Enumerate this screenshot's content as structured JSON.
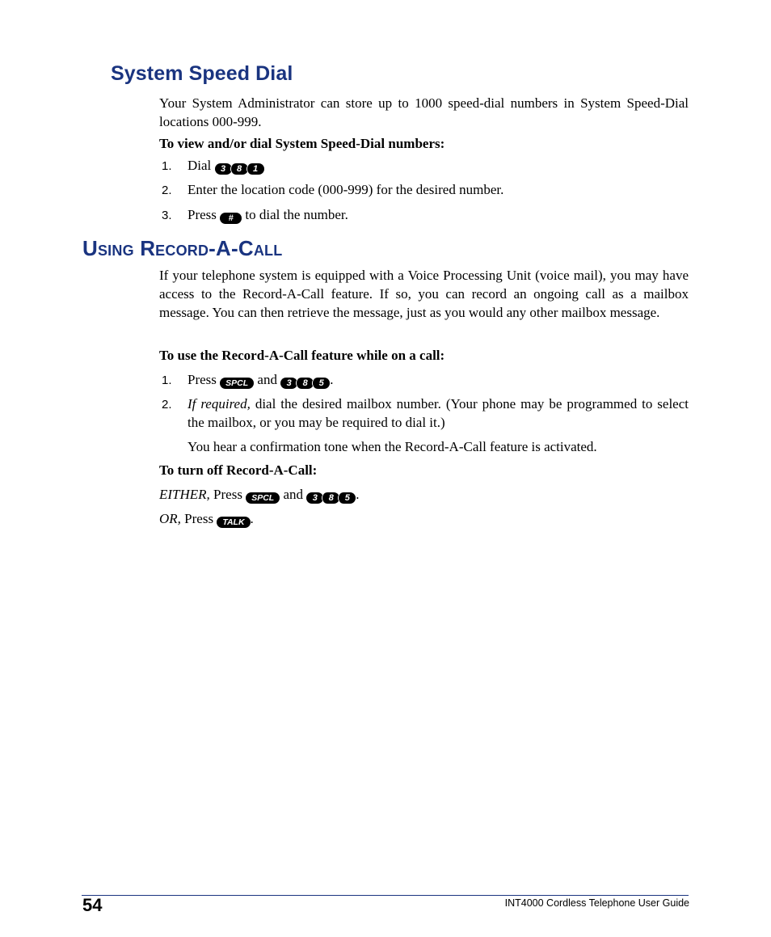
{
  "section1": {
    "heading": "System Speed Dial",
    "intro": "Your System Administrator can store up to 1000 speed-dial numbers in System Speed-Dial locations 000-999.",
    "subheading": "To view and/or dial System Speed-Dial numbers:",
    "steps": [
      {
        "num": "1.",
        "before": "Dial",
        "keys": [
          "3",
          "8",
          "1"
        ],
        "after": ""
      },
      {
        "num": "2.",
        "text": "Enter the location code (000-999) for the desired number."
      },
      {
        "num": "3.",
        "before": "Press",
        "key": "#",
        "after": "to dial the number."
      }
    ]
  },
  "section2": {
    "heading": "Using Record-A-Call",
    "intro": "If your telephone system is equipped with a Voice Processing Unit (voice mail), you may have access to the Record-A-Call feature. If so, you can record an ongoing call as a mailbox message. You can then retrieve the message, just as you would any other mailbox message.",
    "subheading": "To use the Record-A-Call feature while on a call:",
    "steps": [
      {
        "num": "1.",
        "before": "Press",
        "key": "SPCL",
        "mid": "and",
        "keys": [
          "3",
          "8",
          "5"
        ],
        "after": "."
      },
      {
        "num": "2.",
        "italic": "If required,",
        "text": "dial the desired mailbox number. (Your phone may be programmed to select the mailbox, or you may be required to dial it.)"
      }
    ],
    "note": "You hear a confirmation tone when the Record-A-Call feature is activated.",
    "turn_off_heading": "To turn off Record-A-Call:",
    "either": {
      "italic": "EITHER,",
      "before": "Press",
      "key": "SPCL",
      "mid": "and",
      "keys": [
        "3",
        "8",
        "5"
      ],
      "after": "."
    },
    "or": {
      "italic": "OR,",
      "before": "Press",
      "key": "TALK",
      "after": "."
    }
  },
  "footer": {
    "page_number": "54",
    "title": "INT4000 Cordless Telephone User Guide",
    "rule_color": "#1a3480"
  },
  "colors": {
    "heading": "#1a3480",
    "key_bg": "#000000",
    "key_text": "#ffffff"
  }
}
